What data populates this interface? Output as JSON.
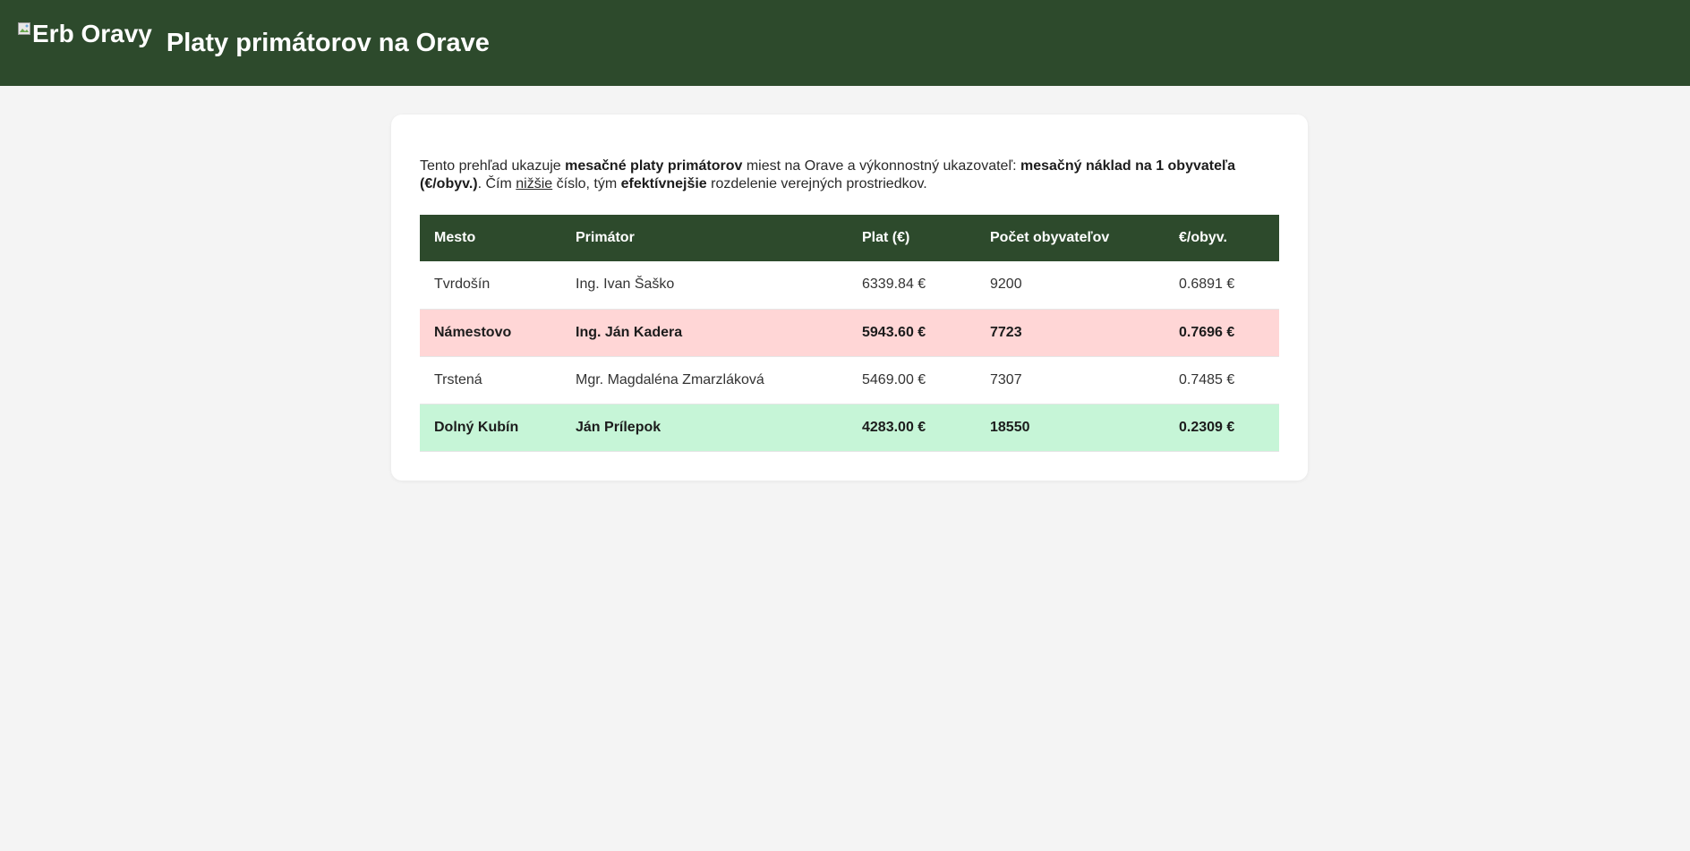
{
  "header": {
    "logo_alt": "Erb Oravy",
    "logo_icon": "broken-image-icon",
    "title": "Platy primátorov na Orave",
    "background": "#2d4a2c"
  },
  "intro": {
    "t1": "Tento prehľad ukazuje ",
    "b1": "mesačné platy primátorov",
    "t2": " miest na Orave a výkonnostný ukazovateľ: ",
    "b2": "mesačný náklad na 1 obyvateľa (€/obyv.)",
    "t3": ". Čím ",
    "u1": "nižšie",
    "t4": " číslo, tým ",
    "b3": "efektívnejšie",
    "t5": " rozdelenie verejných prostriedkov."
  },
  "table": {
    "headers": [
      "Mesto",
      "Primátor",
      "Plat (€)",
      "Počet obyvateľov",
      "€/obyv."
    ],
    "rows": [
      {
        "mesto": "Tvrdošín",
        "primator": "Ing. Ivan Šaško",
        "plat": "6339.84 €",
        "pocet": "9200",
        "eur": "0.6891 €"
      },
      {
        "mesto": "Námestovo",
        "primator": "Ing. Ján Kadera",
        "plat": "5943.60 €",
        "pocet": "7723",
        "eur": "0.7696 €"
      },
      {
        "mesto": "Trstená",
        "primator": "Mgr. Magdaléna Zmarzláková",
        "plat": "5469.00 €",
        "pocet": "7307",
        "eur": "0.7485 €"
      },
      {
        "mesto": "Dolný Kubín",
        "primator": "Ján Prílepok",
        "plat": "4283.00 €",
        "pocet": "18550",
        "eur": "0.2309 €"
      }
    ],
    "highlight_colors": {
      "worst": "#ffd6d6",
      "best": "#c6f5d7"
    }
  }
}
